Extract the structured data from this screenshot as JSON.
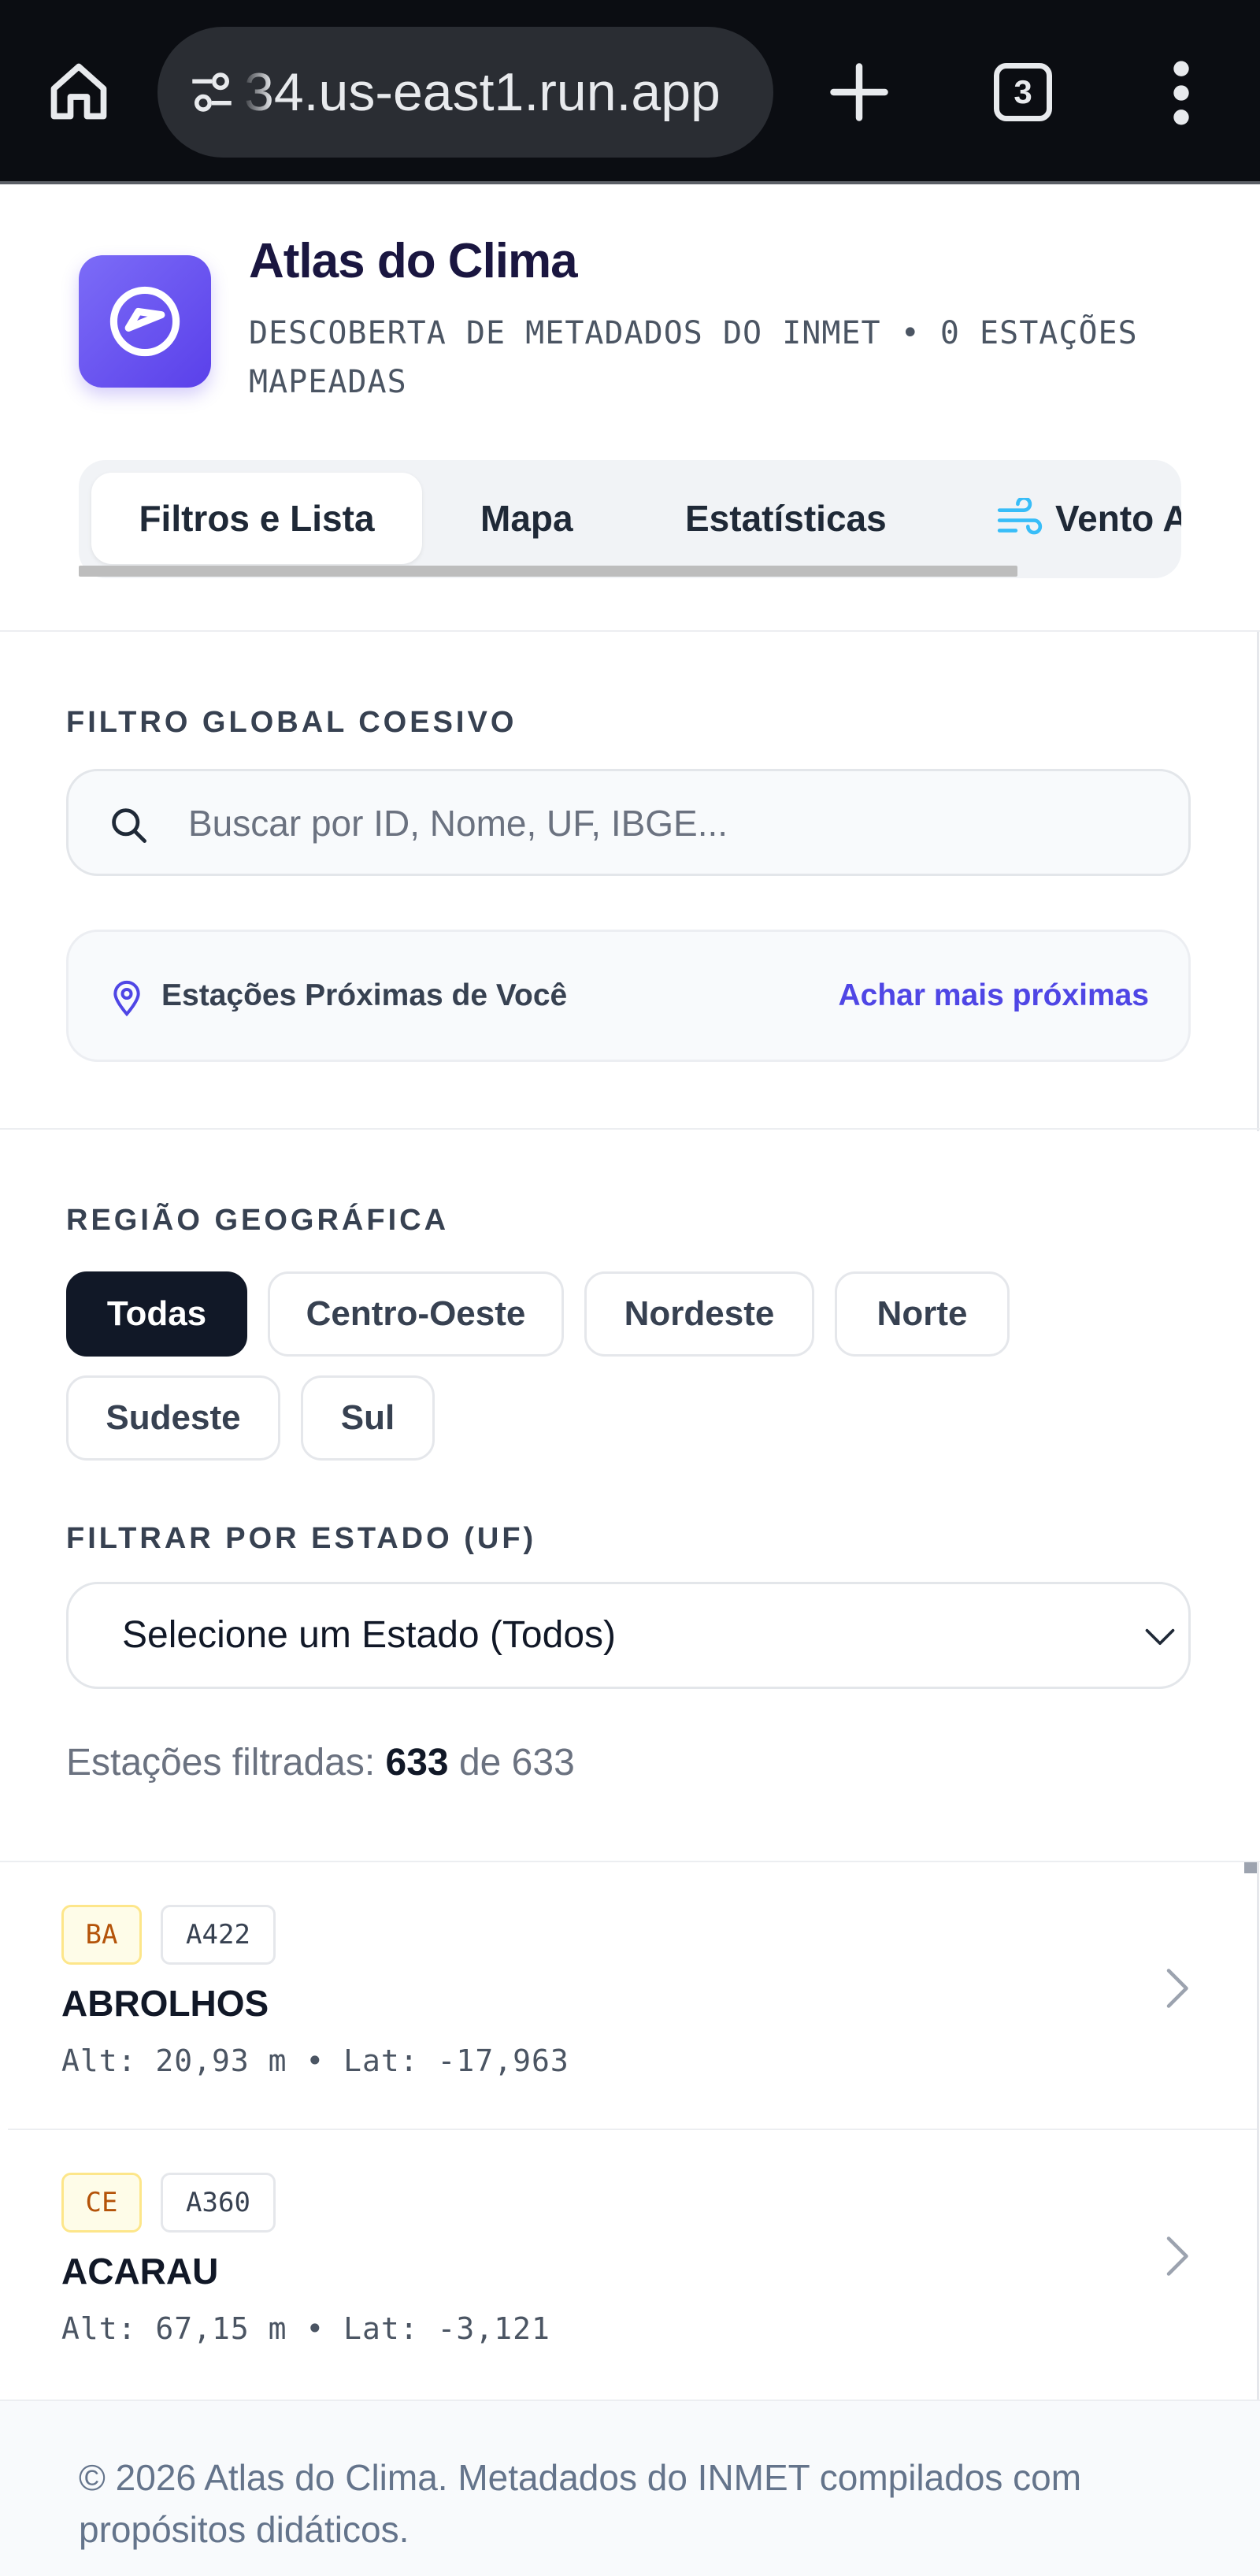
{
  "browser": {
    "url": "34.us-east1.run.app",
    "tab_count": "3"
  },
  "app": {
    "title": "Atlas do Clima",
    "subtitle": "DESCOBERTA DE METADADOS DO INMET • 0 ESTAÇÕES MAPEADAS"
  },
  "tabs": [
    {
      "label": "Filtros e Lista",
      "active": true
    },
    {
      "label": "Mapa"
    },
    {
      "label": "Estatísticas"
    },
    {
      "label": "Vento A"
    }
  ],
  "filter": {
    "section_label": "FILTRO GLOBAL COESIVO",
    "search_placeholder": "Buscar por ID, Nome, UF, IBGE...",
    "nearby_label": "Estações Próximas de Você",
    "nearby_action": "Achar mais próximas"
  },
  "region": {
    "section_label": "REGIÃO GEOGRÁFICA",
    "chips": [
      {
        "label": "Todas",
        "active": true
      },
      {
        "label": "Centro-Oeste"
      },
      {
        "label": "Nordeste"
      },
      {
        "label": "Norte"
      },
      {
        "label": "Sudeste"
      },
      {
        "label": "Sul"
      }
    ]
  },
  "state": {
    "section_label": "FILTRAR POR ESTADO (UF)",
    "selected": "Selecione um Estado (Todos)"
  },
  "count": {
    "prefix": "Estações filtradas: ",
    "filtered": "633",
    "middle": " de ",
    "total": "633"
  },
  "stations": [
    {
      "uf": "BA",
      "code": "A422",
      "name": "ABROLHOS",
      "meta": "Alt: 20,93 m • Lat: -17,963"
    },
    {
      "uf": "CE",
      "code": "A360",
      "name": "ACARAU",
      "meta": "Alt: 67,15 m • Lat: -3,121"
    }
  ],
  "footer": {
    "text": "© 2026 Atlas do Clima. Metadados do INMET compilados com propósitos didáticos."
  },
  "colors": {
    "accent": "#5a40ea",
    "link": "#4f46e5",
    "chip_active": "#111827",
    "uf_badge_bg": "#fefce8",
    "uf_badge_text": "#b45309"
  }
}
